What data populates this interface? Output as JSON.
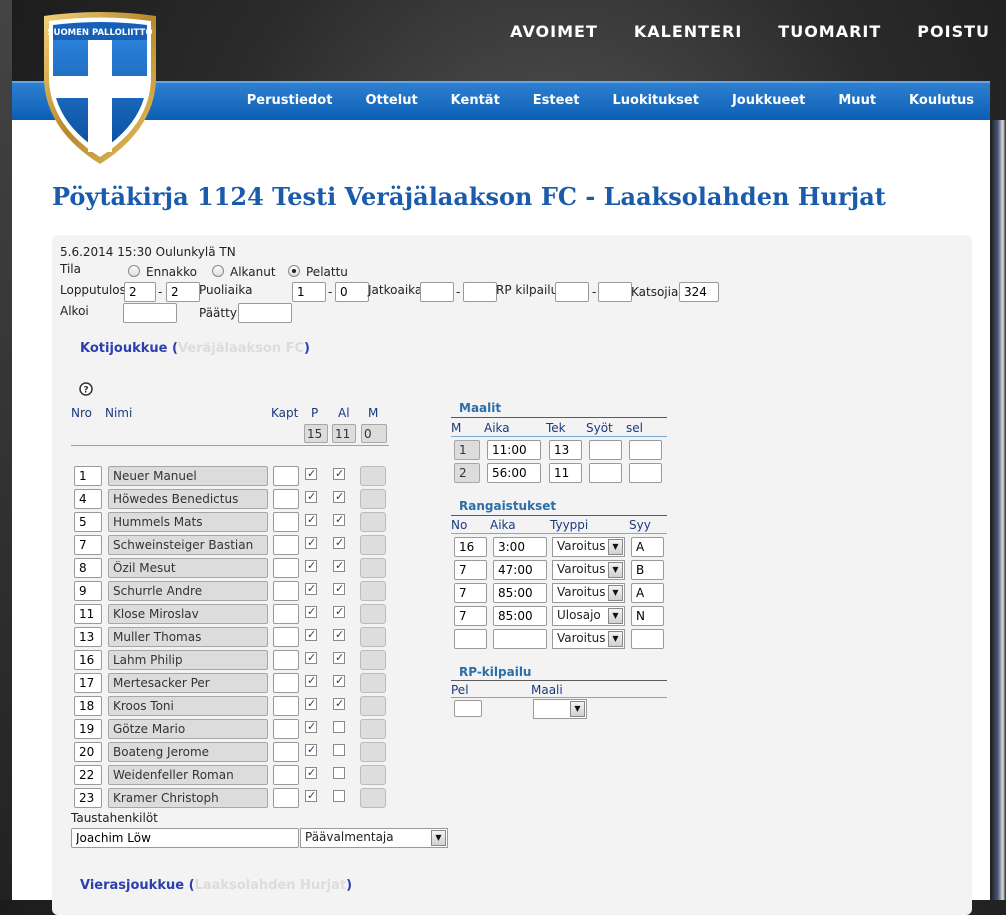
{
  "brand": {
    "logo_text": "SUOMEN PALLOLIITTO"
  },
  "topnav": [
    "AVOIMET",
    "KALENTERI",
    "TUOMARIT",
    "POISTU"
  ],
  "menu": [
    "Perustiedot",
    "Ottelut",
    "Kentät",
    "Esteet",
    "Luokitukset",
    "Joukkueet",
    "Muut",
    "Koulutus"
  ],
  "page_title": "Pöytäkirja 1124 Testi Veräjälaakson FC - Laaksolahden Hurjat",
  "match": {
    "datetime_place": "5.6.2014 15:30 Oulunkylä TN",
    "tila_label": "Tila",
    "states": [
      "Ennakko",
      "Alkanut",
      "Pelattu"
    ],
    "lopputulos_label": "Lopputulos",
    "lopputulos_home": "2",
    "lopputulos_away": "2",
    "puoliaika_label": "Puoliaika",
    "puoliaika_home": "1",
    "puoliaika_away": "0",
    "jatkoaika_label": "Jatkoaika",
    "rp_label": "RP kilpailu",
    "katsojia_label": "Katsojia",
    "katsojia": "324",
    "alkoi_label": "Alkoi",
    "paattyi_label": "Päättyi",
    "dash": "-"
  },
  "home": {
    "label": "Kotijoukkue",
    "name": "Veräjälaakson FC",
    "open": "(",
    "close": ")",
    "cols": {
      "nro": "Nro",
      "nimi": "Nimi",
      "kapt": "Kapt",
      "p": "P",
      "al": "Al",
      "m": "M"
    },
    "totals": {
      "p": "15",
      "al": "11",
      "m": "0"
    },
    "players": [
      {
        "no": "1",
        "name": "Neuer Manuel",
        "p": true,
        "al": true
      },
      {
        "no": "4",
        "name": "Höwedes Benedictus",
        "p": true,
        "al": true
      },
      {
        "no": "5",
        "name": "Hummels Mats",
        "p": true,
        "al": true
      },
      {
        "no": "7",
        "name": "Schweinsteiger Bastian",
        "p": true,
        "al": true
      },
      {
        "no": "8",
        "name": "Özil Mesut",
        "p": true,
        "al": true
      },
      {
        "no": "9",
        "name": "Schurrle Andre",
        "p": true,
        "al": true
      },
      {
        "no": "11",
        "name": "Klose Miroslav",
        "p": true,
        "al": true
      },
      {
        "no": "13",
        "name": "Muller Thomas",
        "p": true,
        "al": true
      },
      {
        "no": "16",
        "name": "Lahm Philip",
        "p": true,
        "al": true
      },
      {
        "no": "17",
        "name": "Mertesacker Per",
        "p": true,
        "al": true
      },
      {
        "no": "18",
        "name": "Kroos Toni",
        "p": true,
        "al": true
      },
      {
        "no": "19",
        "name": "Götze Mario",
        "p": true,
        "al": false
      },
      {
        "no": "20",
        "name": "Boateng Jerome",
        "p": true,
        "al": false
      },
      {
        "no": "22",
        "name": "Weidenfeller Roman",
        "p": true,
        "al": false
      },
      {
        "no": "23",
        "name": "Kramer Christoph",
        "p": true,
        "al": false
      }
    ],
    "staff_label": "Taustahenkilöt",
    "staff_name": "Joachim Löw",
    "staff_role": "Päävalmentaja"
  },
  "goals": {
    "title": "Maalit",
    "cols": {
      "m": "M",
      "aika": "Aika",
      "tek": "Tek",
      "syot": "Syöt",
      "sel": "sel"
    },
    "rows": [
      {
        "m": "1",
        "aika": "11:00",
        "tek": "13"
      },
      {
        "m": "2",
        "aika": "56:00",
        "tek": "11"
      }
    ]
  },
  "penalties": {
    "title": "Rangaistukset",
    "cols": {
      "no": "No",
      "aika": "Aika",
      "tyyppi": "Tyyppi",
      "syy": "Syy"
    },
    "rows": [
      {
        "no": "16",
        "aika": "3:00",
        "tyyppi": "Varoitus",
        "syy": "A"
      },
      {
        "no": "7",
        "aika": "47:00",
        "tyyppi": "Varoitus",
        "syy": "B"
      },
      {
        "no": "7",
        "aika": "85:00",
        "tyyppi": "Varoitus",
        "syy": "A"
      },
      {
        "no": "7",
        "aika": "85:00",
        "tyyppi": "Ulosajo",
        "syy": "N"
      },
      {
        "no": "",
        "aika": "",
        "tyyppi": "Varoitus",
        "syy": ""
      }
    ]
  },
  "rp": {
    "title": "RP-kilpailu",
    "pel": "Pel",
    "maali": "Maali"
  },
  "away": {
    "label": "Vierasjoukkue",
    "name": "Laaksolahden Hurjat",
    "open": "(",
    "close": ")"
  },
  "colors": {
    "brand_blue": "#1b5bab",
    "menu_blue": "#0b5fb3"
  }
}
